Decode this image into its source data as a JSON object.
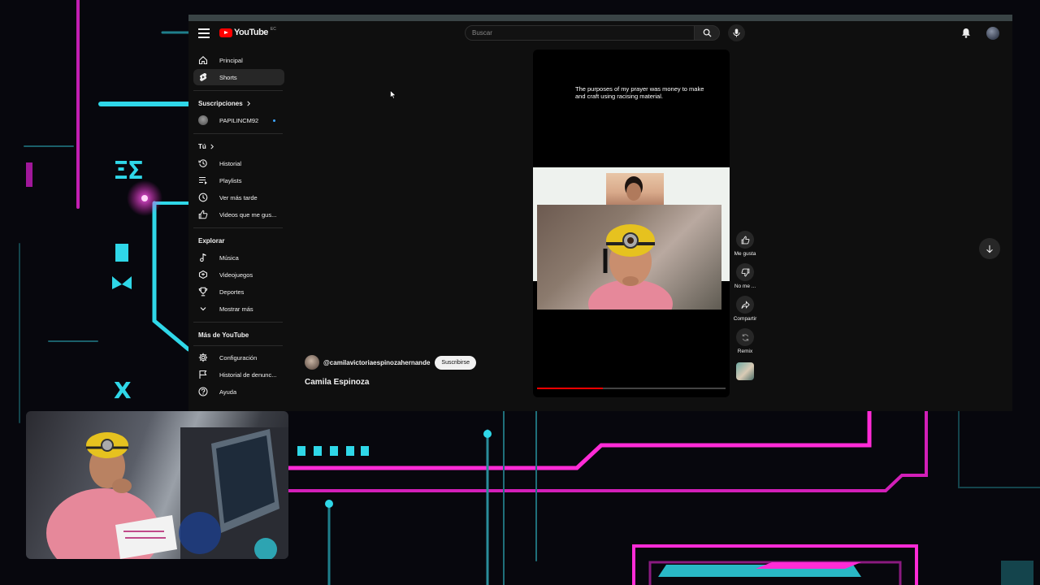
{
  "overlay": {
    "watermark_text": ""
  },
  "header": {
    "logo_text": "YouTube",
    "country_code": "EC",
    "search_placeholder": "Buscar"
  },
  "sidebar": {
    "main": [
      {
        "label": "Principal",
        "icon": "home-icon"
      },
      {
        "label": "Shorts",
        "icon": "shorts-icon",
        "active": true
      }
    ],
    "subscriptions_title": "Suscripciones",
    "subscriptions": [
      {
        "label": "PAPILINCM92",
        "new_content": true
      }
    ],
    "you_title": "Tú",
    "you": [
      {
        "label": "Historial",
        "icon": "history-icon"
      },
      {
        "label": "Playlists",
        "icon": "playlists-icon"
      },
      {
        "label": "Ver más tarde",
        "icon": "watch-later-icon"
      },
      {
        "label": "Videos que me gus...",
        "icon": "liked-videos-icon"
      }
    ],
    "explore_title": "Explorar",
    "explore": [
      {
        "label": "Música",
        "icon": "music-icon"
      },
      {
        "label": "Videojuegos",
        "icon": "gaming-icon"
      },
      {
        "label": "Deportes",
        "icon": "trophy-icon"
      },
      {
        "label": "Mostrar más",
        "icon": "chevron-down-icon"
      }
    ],
    "more_title": "Más de YouTube",
    "more": [
      {
        "label": "Configuración",
        "icon": "gear-icon"
      },
      {
        "label": "Historial de denunc...",
        "icon": "flag-icon"
      },
      {
        "label": "Ayuda",
        "icon": "help-icon"
      }
    ]
  },
  "short": {
    "caption": "The purposes of my prayer was money to make and craft using racising material.",
    "channel_handle": "@camilavictoriaespinozahernande",
    "subscribe_label": "Suscribirse",
    "channel_name": "Camila Espinoza",
    "progress": 0.35
  },
  "actions": {
    "like": "Me gusta",
    "dislike": "No me ...",
    "share": "Compartir",
    "remix": "Remix"
  },
  "colors": {
    "youtube_red": "#ff0000",
    "background": "#0f0f0f",
    "neon_pink": "#ff2bd6",
    "neon_cyan": "#2fd7e8"
  }
}
